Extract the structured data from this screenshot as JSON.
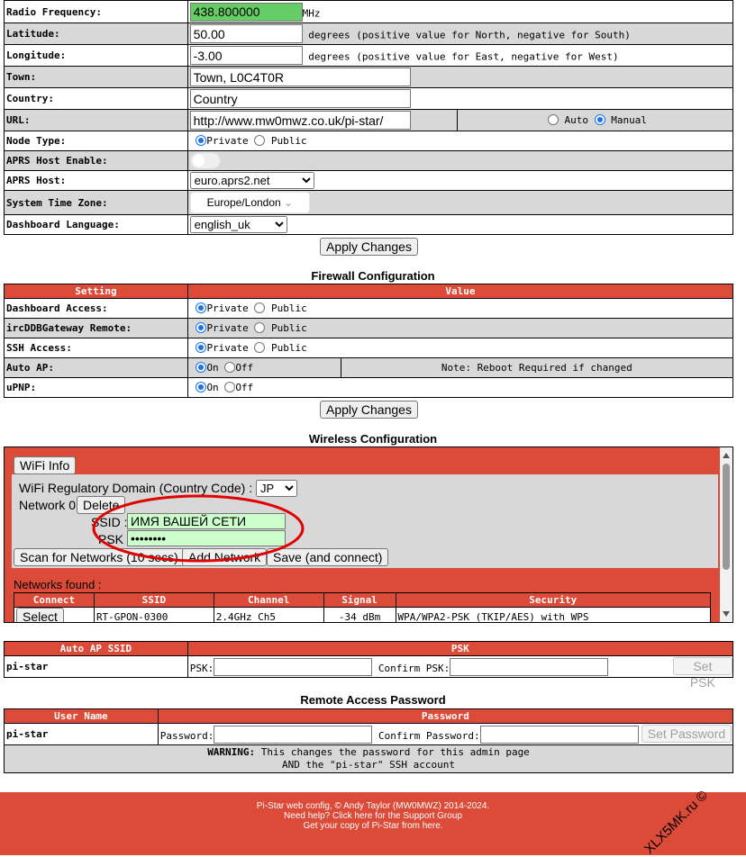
{
  "general": {
    "radio_frequency": {
      "label": "Radio Frequency:",
      "value": "438.800000",
      "unit": "MHz"
    },
    "latitude": {
      "label": "Latitude:",
      "value": "50.00",
      "hint": "degrees (positive value for North, negative for South)"
    },
    "longitude": {
      "label": "Longitude:",
      "value": "-3.00",
      "hint": "degrees (positive value for East, negative for West)"
    },
    "town": {
      "label": "Town:",
      "value": "Town, L0C4T0R"
    },
    "country": {
      "label": "Country:",
      "value": "Country"
    },
    "url": {
      "label": "URL:",
      "value": "http://www.mw0mwz.co.uk/pi-star/",
      "auto": "Auto",
      "manual": "Manual"
    },
    "node_type": {
      "label": "Node Type:",
      "private": "Private",
      "public": "Public"
    },
    "aprs_enable": {
      "label": "APRS Host Enable:"
    },
    "aprs_host": {
      "label": "APRS Host:",
      "value": "euro.aprs2.net"
    },
    "time_zone": {
      "label": "System Time Zone:",
      "value": "Europe/London"
    },
    "language": {
      "label": "Dashboard Language:",
      "value": "english_uk"
    },
    "apply": "Apply Changes"
  },
  "firewall": {
    "title": "Firewall Configuration",
    "col_setting": "Setting",
    "col_value": "Value",
    "rows": [
      {
        "label": "Dashboard Access:",
        "a": "Private",
        "b": "Public"
      },
      {
        "label": "ircDDBGateway Remote:",
        "a": "Private",
        "b": "Public"
      },
      {
        "label": "SSH Access:",
        "a": "Private",
        "b": "Public"
      },
      {
        "label": "Auto AP:",
        "a": "On",
        "b": "Off",
        "note": "Note: Reboot Required if changed"
      },
      {
        "label": "uPNP:",
        "a": "On",
        "b": "Off"
      }
    ],
    "apply": "Apply Changes"
  },
  "wireless": {
    "title": "Wireless Configuration",
    "wifi_info": "WiFi Info",
    "reg_label": "WiFi Regulatory Domain (Country Code) :",
    "reg_value": "JP",
    "network_label": "Network 0",
    "delete": "Delete",
    "ssid_label": "SSID :",
    "ssid_value": "ИМЯ ВАШЕЙ СЕТИ",
    "psk_label": "PSK :",
    "psk_value": "••••••••",
    "scan": "Scan for Networks (10 secs)",
    "add": "Add Network",
    "save": "Save (and connect)",
    "found": "Networks found :",
    "headers": [
      "Connect",
      "SSID",
      "Channel",
      "Signal",
      "Security"
    ],
    "row": {
      "select": "Select",
      "ssid": "RT-GPON-0300",
      "channel": "2.4GHz Ch5",
      "signal": "-34 dBm",
      "security": "WPA/WPA2-PSK (TKIP/AES) with WPS"
    }
  },
  "autoap": {
    "col1": "Auto AP SSID",
    "col2": "PSK",
    "ssid": "pi-star",
    "psk_label": "PSK:",
    "confirm_label": "Confirm PSK:",
    "set": "Set PSK"
  },
  "remote": {
    "title": "Remote Access Password",
    "col1": "User Name",
    "col2": "Password",
    "user": "pi-star",
    "pw_label": "Password:",
    "confirm_label": "Confirm Password:",
    "set": "Set Password",
    "warn_bold": "WARNING:",
    "warn1": " This changes the password for this admin page",
    "warn2": "AND the \"pi-star\" SSH account"
  },
  "footer": {
    "line1": "Pi-Star web config, © Andy Taylor (MW0MWZ) 2014-2024.",
    "line2": "Need help? Click here for the Support Group",
    "line3": "Get your copy of Pi-Star from here.",
    "watermark": "XLX5MK.ru ©"
  },
  "colors": {
    "header_red": "#dc4a38",
    "freq_green": "#66cc66",
    "ssid_green": "#ccffcc",
    "annotation_red": "#e00000"
  }
}
